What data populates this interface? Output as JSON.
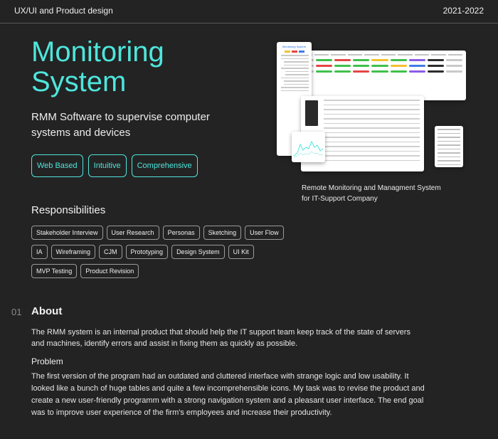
{
  "header": {
    "left": "UX/UI and Product design",
    "right": "2021-2022"
  },
  "hero": {
    "title_line1": "Monitoring",
    "title_line2": "System",
    "subtitle_line1": "RMM Software to supervise computer",
    "subtitle_line2": "systems and devices",
    "pills": [
      "Web Based",
      "Intuitive",
      "Comprehensive"
    ]
  },
  "mockup": {
    "app_title": "Monitoring System",
    "caption_line1": "Remote Monitoring and Managment System",
    "caption_line2": "for IT-Support Company"
  },
  "responsibilities": {
    "title": "Responsibilities",
    "tags": [
      "Stakeholder Interview",
      "User Research",
      "Personas",
      "Sketching",
      "User Flow",
      "IA",
      "Wireframing",
      "CJM",
      "Prototyping",
      "Design System",
      "UI Kit",
      "MVP Testing",
      "Product Revision"
    ]
  },
  "about": {
    "number": "01",
    "title": "About",
    "text": "The RMM system is an internal product that should help the IT support team keep track of the state of servers and machines, identify errors and assist in fixing them as quickly as possible.",
    "problem_title": "Problem",
    "problem_text": "The first version of the program had an outdated and cluttered interface with strange logic and low usability. It looked like a bunch of huge tables and quite a few incomprehensible icons. My task was to revise the product and create a new user-friendly programm with a strong navigation system and a pleasant user interface. The end goal was to improve user experience of the firm's employees and increase their productivity."
  },
  "colors": {
    "background": "#232323",
    "accent": "#4ee6dc",
    "text": "#e8e8e8",
    "muted": "#8a8a8a",
    "status_green": "#3fc04a",
    "status_red": "#e64545",
    "status_yellow": "#f2c12e",
    "status_purple": "#8a5ce6",
    "status_blue": "#3d7ce8",
    "status_dark": "#2c2c2c"
  }
}
